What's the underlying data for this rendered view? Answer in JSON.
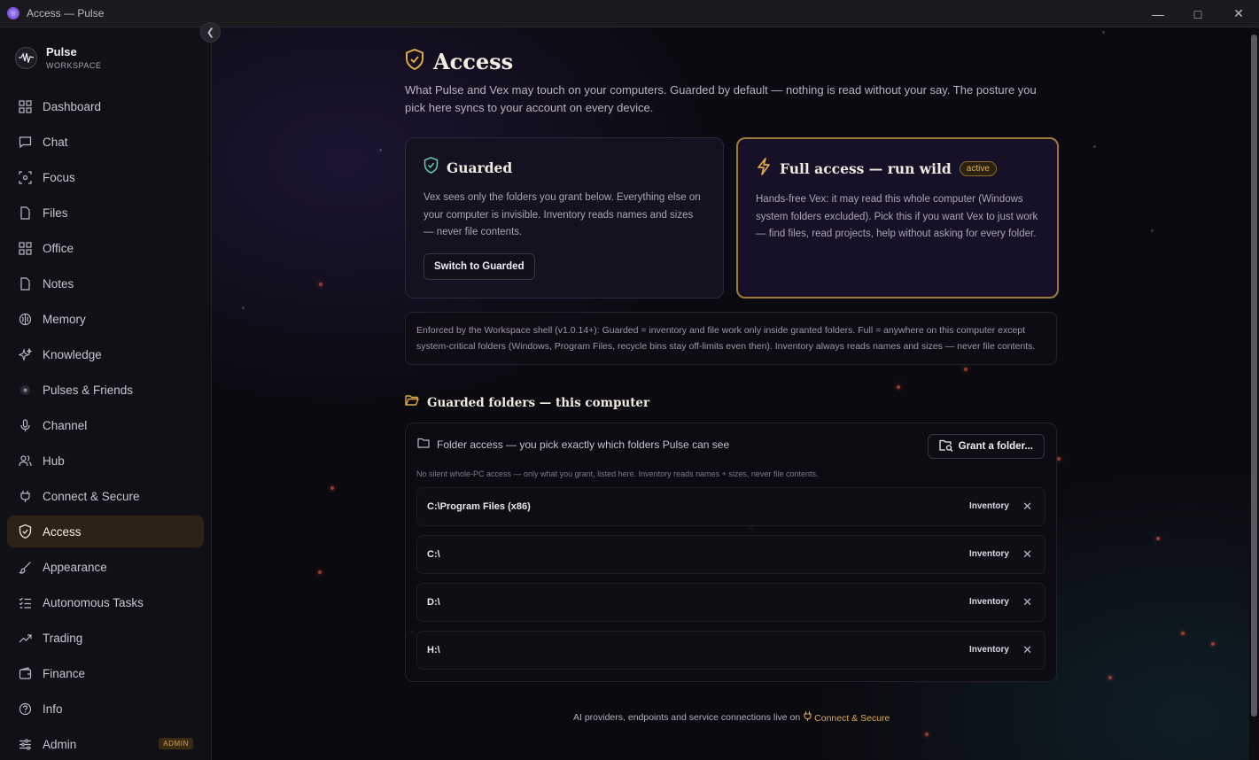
{
  "window": {
    "title": "Access — Pulse"
  },
  "brand": {
    "name": "Pulse",
    "subtitle": "WORKSPACE"
  },
  "sidebar": {
    "items": [
      {
        "label": "Dashboard",
        "icon": "grid-icon"
      },
      {
        "label": "Chat",
        "icon": "chat-icon"
      },
      {
        "label": "Focus",
        "icon": "focus-icon"
      },
      {
        "label": "Files",
        "icon": "file-icon"
      },
      {
        "label": "Office",
        "icon": "grid-icon"
      },
      {
        "label": "Notes",
        "icon": "note-icon"
      },
      {
        "label": "Memory",
        "icon": "brain-icon"
      },
      {
        "label": "Knowledge",
        "icon": "sparkle-icon"
      },
      {
        "label": "Pulses & Friends",
        "icon": "dot-icon"
      },
      {
        "label": "Channel",
        "icon": "mic-icon"
      },
      {
        "label": "Hub",
        "icon": "users-icon"
      },
      {
        "label": "Connect & Secure",
        "icon": "plug-icon"
      },
      {
        "label": "Access",
        "icon": "shield-icon",
        "active": true
      },
      {
        "label": "Appearance",
        "icon": "brush-icon"
      },
      {
        "label": "Autonomous Tasks",
        "icon": "checklist-icon"
      },
      {
        "label": "Trading",
        "icon": "trend-icon"
      },
      {
        "label": "Finance",
        "icon": "wallet-icon"
      },
      {
        "label": "Info",
        "icon": "help-icon"
      },
      {
        "label": "Admin",
        "icon": "sliders-icon",
        "badge": "ADMIN"
      }
    ]
  },
  "page": {
    "title": "Access",
    "description": "What Pulse and Vex may touch on your computers. Guarded by default — nothing is read without your say. The posture you pick here syncs to your account on every device."
  },
  "posture": {
    "guarded": {
      "title": "Guarded",
      "body": "Vex sees only the folders you grant below. Everything else on your computer is invisible. Inventory reads names and sizes — never file contents.",
      "button": "Switch to Guarded"
    },
    "full": {
      "title": "Full access — run wild",
      "active_label": "active",
      "body": "Hands-free Vex: it may read this whole computer (Windows system folders excluded). Pick this if you want Vex to just work — find files, read projects, help without asking for every folder."
    }
  },
  "enforcement_note": "Enforced by the Workspace shell (v1.0.14+): Guarded = inventory and file work only inside granted folders. Full = anywhere on this computer except system-critical folders (Windows, Program Files, recycle bins stay off-limits even then). Inventory always reads names and sizes — never file contents.",
  "folders_section": {
    "title": "Guarded folders — this computer",
    "panel_title": "Folder access — you pick exactly which folders Pulse can see",
    "grant_button": "Grant a folder...",
    "subtitle": "No silent whole-PC access — only what you grant, listed here. Inventory reads names + sizes, never file contents.",
    "rows": [
      {
        "path": "C:\\Program Files (x86)",
        "mode": "Inventory"
      },
      {
        "path": "C:\\",
        "mode": "Inventory"
      },
      {
        "path": "D:\\",
        "mode": "Inventory"
      },
      {
        "path": "H:\\",
        "mode": "Inventory"
      }
    ],
    "remove_symbol": "✕"
  },
  "footer": {
    "text": "AI providers, endpoints and service connections live on",
    "link": "Connect & Secure"
  },
  "colors": {
    "accent": "#e0aa4a",
    "active_nav_bg": "#2d2315",
    "guarded_icon": "#5ec9a8",
    "ember": "#e0553a"
  }
}
